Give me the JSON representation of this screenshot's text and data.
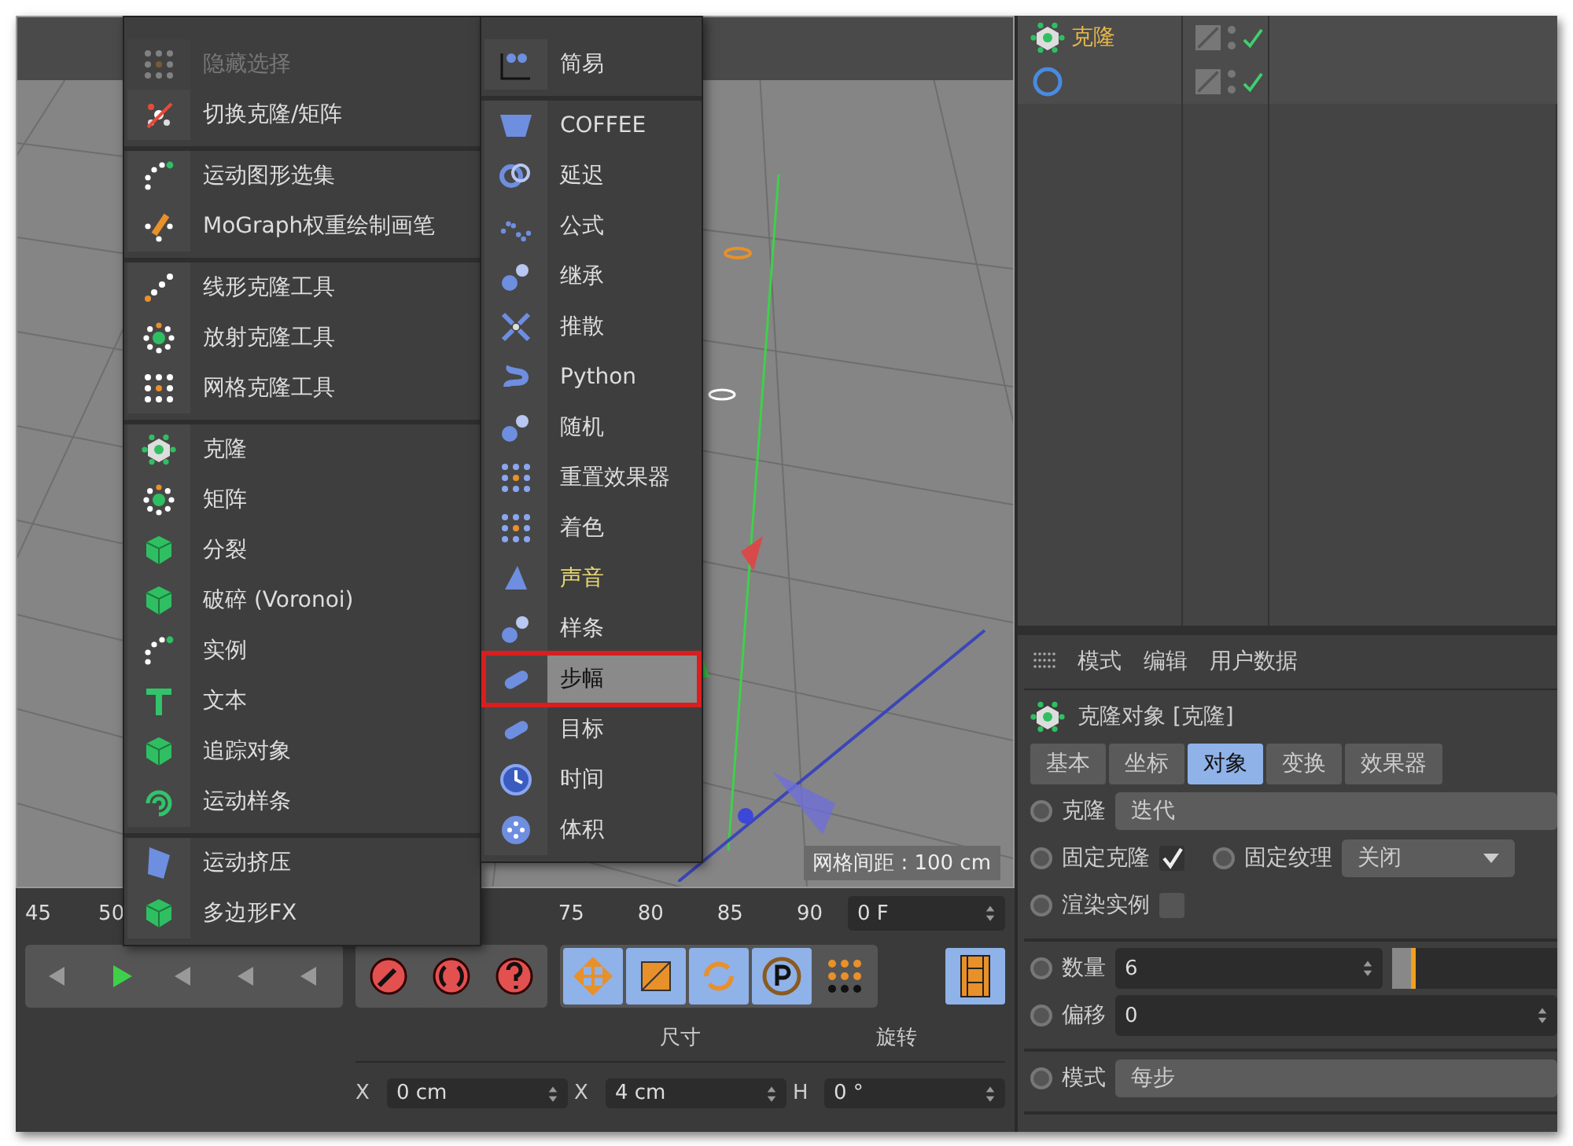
{
  "main_menu": {
    "sections": [
      [
        {
          "label": "隐藏选择",
          "disabled": true
        },
        {
          "label": "切换克隆/矩阵",
          "disabled": false
        }
      ],
      [
        {
          "label": "运动图形选集",
          "disabled": false
        },
        {
          "label": "MoGraph权重绘制画笔",
          "disabled": false
        }
      ],
      [
        {
          "label": "线形克隆工具",
          "disabled": false
        },
        {
          "label": "放射克隆工具",
          "disabled": false
        },
        {
          "label": "网格克隆工具",
          "disabled": false
        }
      ],
      [
        {
          "label": "克隆",
          "disabled": false
        },
        {
          "label": "矩阵",
          "disabled": false
        },
        {
          "label": "分裂",
          "disabled": false
        },
        {
          "label": "破碎 (Voronoi)",
          "disabled": false
        },
        {
          "label": "实例",
          "disabled": false
        },
        {
          "label": "文本",
          "disabled": false
        },
        {
          "label": "追踪对象",
          "disabled": false
        },
        {
          "label": "运动样条",
          "disabled": false
        }
      ],
      [
        {
          "label": "运动挤压",
          "disabled": false
        },
        {
          "label": "多边形FX",
          "disabled": false
        }
      ]
    ]
  },
  "effector_menu": {
    "sections": [
      [
        {
          "label": "简易",
          "selected": false,
          "highlighted": false
        }
      ],
      [
        {
          "label": "COFFEE",
          "selected": false,
          "highlighted": false
        },
        {
          "label": "延迟",
          "selected": false,
          "highlighted": false
        },
        {
          "label": "公式",
          "selected": false,
          "highlighted": false
        },
        {
          "label": "继承",
          "selected": false,
          "highlighted": false
        },
        {
          "label": "推散",
          "selected": false,
          "highlighted": false
        },
        {
          "label": "Python",
          "selected": false,
          "highlighted": false
        },
        {
          "label": "随机",
          "selected": false,
          "highlighted": false
        },
        {
          "label": "重置效果器",
          "selected": false,
          "highlighted": false
        },
        {
          "label": "着色",
          "selected": false,
          "highlighted": false
        },
        {
          "label": "声音",
          "selected": false,
          "highlighted": true
        },
        {
          "label": "样条",
          "selected": false,
          "highlighted": false
        },
        {
          "label": "步幅",
          "selected": true,
          "highlighted": false
        },
        {
          "label": "目标",
          "selected": false,
          "highlighted": false
        },
        {
          "label": "时间",
          "selected": false,
          "highlighted": false
        },
        {
          "label": "体积",
          "selected": false,
          "highlighted": false
        }
      ]
    ]
  },
  "viewport": {
    "grid_label": "网格间距 : 100 cm"
  },
  "timeline": {
    "left_ticks": [
      "45",
      "50"
    ],
    "right_ticks": [
      "75",
      "80",
      "85",
      "90"
    ],
    "frame_field": "0 F"
  },
  "coordinates": {
    "headers": [
      "尺寸",
      "旋转"
    ],
    "fields": [
      {
        "axis": "X",
        "value": "0 cm"
      },
      {
        "axis": "X",
        "value": "4 cm"
      },
      {
        "axis": "H",
        "value": "0 °"
      }
    ]
  },
  "object_manager": {
    "rows": [
      {
        "kind": "clone",
        "name": "克隆"
      },
      {
        "kind": "circle"
      }
    ]
  },
  "attributes": {
    "menu": [
      "模式",
      "编辑",
      "用户数据"
    ],
    "title": "克隆对象 [克隆]",
    "tabs": [
      {
        "label": "基本",
        "selected": false
      },
      {
        "label": "坐标",
        "selected": false
      },
      {
        "label": "对象",
        "selected": true
      },
      {
        "label": "变换",
        "selected": false
      },
      {
        "label": "效果器",
        "selected": false
      }
    ],
    "groups": [
      [
        [
          {
            "kind": "select-wide",
            "label": "克隆",
            "value": "迭代",
            "animated": false
          }
        ],
        [
          {
            "kind": "checkbox",
            "label": "固定克隆",
            "checked": true,
            "animated": false
          },
          {
            "kind": "select",
            "label": "固定纹理",
            "value": "关闭",
            "animated": false
          }
        ],
        [
          {
            "kind": "checkbox",
            "label": "渲染实例",
            "checked": false,
            "animated": false
          }
        ]
      ],
      [
        [
          {
            "kind": "number-slider",
            "label": "数量",
            "value": "6",
            "level": 0.14,
            "animated": false
          }
        ],
        [
          {
            "kind": "number",
            "label": "偏移",
            "value": "0",
            "animated": false
          }
        ]
      ],
      [
        [
          {
            "kind": "select-wide",
            "label": "模式",
            "value": "每步",
            "animated": false
          }
        ]
      ]
    ]
  }
}
